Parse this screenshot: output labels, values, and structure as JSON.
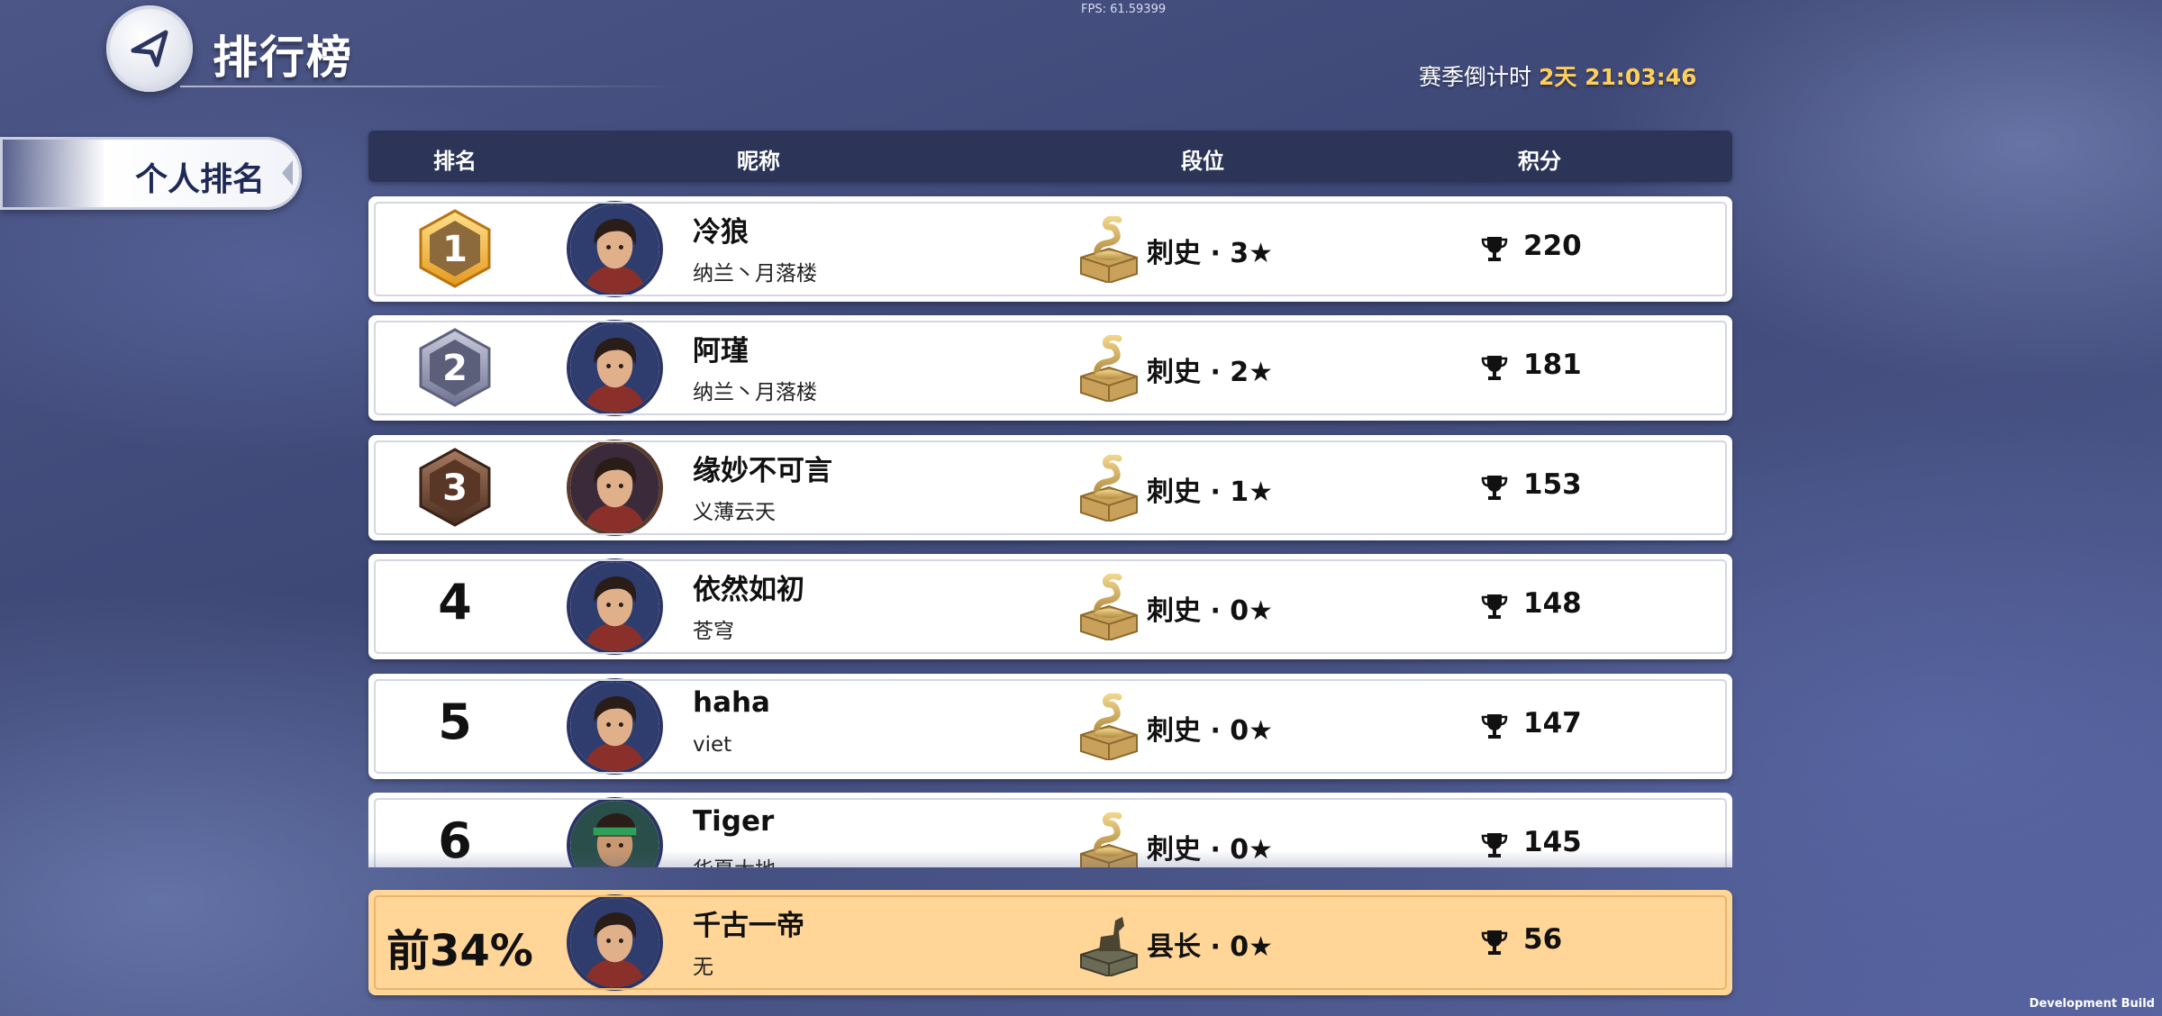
{
  "debug": {
    "fps": "FPS: 61.59399",
    "build": "Development Build"
  },
  "header": {
    "title": "排行榜",
    "countdown_label": "赛季倒计时",
    "countdown_value": "2天 21:03:46"
  },
  "tabs": [
    {
      "label": "个人排名",
      "selected": true
    }
  ],
  "columns": {
    "rank": "排名",
    "nickname": "昵称",
    "tier": "段位",
    "score": "积分"
  },
  "colors": {
    "gold": "#f2b233",
    "silver": "#8b8fa6",
    "bronze": "#6b4430",
    "self_row": "#ffd598",
    "header_bar": "#2c3558",
    "countdown": "#ffcf5a"
  },
  "rows": [
    {
      "rank": "1",
      "badge": "gold",
      "name": "冷狼",
      "guild": "纳兰丶月落楼",
      "tier": "刺史 · 3★",
      "tier_icon": "snake-seal-icon",
      "score": "220"
    },
    {
      "rank": "2",
      "badge": "silver",
      "name": "阿瑾",
      "guild": "纳兰丶月落楼",
      "tier": "刺史 · 2★",
      "tier_icon": "snake-seal-icon",
      "score": "181"
    },
    {
      "rank": "3",
      "badge": "bronze",
      "name": "缘妙不可言",
      "guild": "义薄云天",
      "tier": "刺史 · 1★",
      "tier_icon": "snake-seal-icon",
      "score": "153"
    },
    {
      "rank": "4",
      "name": "依然如初",
      "guild": "苍穹",
      "tier": "刺史 · 0★",
      "tier_icon": "snake-seal-icon",
      "score": "148"
    },
    {
      "rank": "5",
      "name": "haha",
      "guild": "viet",
      "tier": "刺史 · 0★",
      "tier_icon": "snake-seal-icon",
      "score": "147"
    },
    {
      "rank": "6",
      "name": "Tiger",
      "guild": "华夏大地",
      "tier": "刺史 · 0★",
      "tier_icon": "snake-seal-icon",
      "score": "145"
    }
  ],
  "self": {
    "rank": "前34%",
    "name": "千古一帝",
    "guild": "无",
    "tier": "县长 · 0★",
    "tier_icon": "horse-seal-icon",
    "score": "56"
  }
}
